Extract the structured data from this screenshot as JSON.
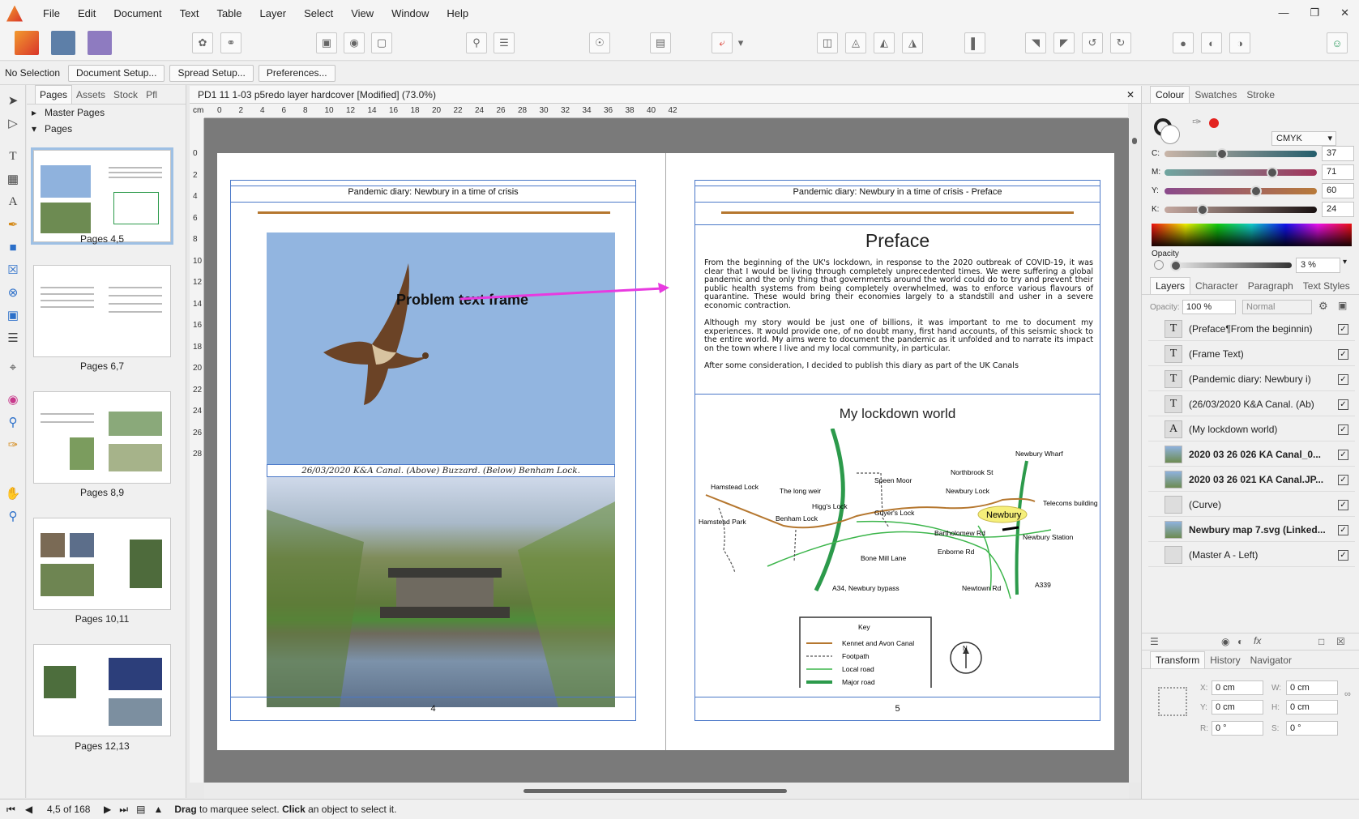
{
  "menu": [
    "File",
    "Edit",
    "Document",
    "Text",
    "Table",
    "Layer",
    "Select",
    "View",
    "Window",
    "Help"
  ],
  "context": {
    "selection": "No Selection",
    "buttons": [
      "Document Setup...",
      "Spread Setup...",
      "Preferences..."
    ]
  },
  "pages_panel": {
    "tabs": [
      "Pages",
      "Assets",
      "Stock",
      "Pfl"
    ],
    "master_pages": "Master Pages",
    "pages": "Pages",
    "thumbs": [
      "Pages 4,5",
      "Pages 6,7",
      "Pages 8,9",
      "Pages 10,11",
      "Pages 12,13"
    ]
  },
  "doc_tab": "PD1 11 1-03 p5redo layer hardcover [Modified] (73.0%)",
  "ruler": {
    "unit": "cm",
    "h": [
      "0",
      "2",
      "4",
      "6",
      "8",
      "10",
      "12",
      "14",
      "16",
      "18",
      "20",
      "22",
      "24",
      "26",
      "28",
      "30",
      "32",
      "34",
      "36",
      "38",
      "40",
      "42"
    ],
    "v": [
      "0",
      "2",
      "4",
      "6",
      "8",
      "10",
      "12",
      "14",
      "16",
      "18",
      "20",
      "22",
      "24",
      "26",
      "28"
    ]
  },
  "left_page": {
    "header": "Pandemic diary: Newbury in a time of crisis",
    "annotation": "Problem text frame",
    "caption": "26/03/2020 K&A Canal. (Above) Buzzard. (Below) Benham Lock.",
    "page_number": "4"
  },
  "right_page": {
    "header": "Pandemic diary: Newbury in a time of crisis - Preface",
    "title": "Preface",
    "para1": "From the beginning of the UK's lockdown, in response to the 2020 outbreak of COVID-19, it was clear that I would be living through completely unprecedented times. We were suffering a global pandemic and the only thing that governments around the world could do to try and prevent their public health systems from being completely overwhelmed, was to enforce various flavours of quarantine. These would bring their economies largely to a standstill and usher in a severe economic contraction.",
    "para2": "Although my story would be just one of billions, it was important to me to document my experiences. It would provide one, of no doubt many, first hand accounts, of this seismic shock to the entire world. My aims were to document the pandemic as it unfolded and to narrate its impact on the town where I live and my local community, in particular.",
    "para3": "After some consideration, I decided to publish this diary as part of the UK Canals",
    "map_title": "My lockdown world",
    "map_labels": {
      "hamstead_lock": "Hamstead Lock",
      "long_weir": "The long weir",
      "hamstead_park": "Hamstead Park",
      "benham_lock": "Benham Lock",
      "higgs_lock": "Higg's Lock",
      "speen_moor": "Speen Moor",
      "guyers_lock": "Guyer's Lock",
      "northbrook": "Northbrook St",
      "newbury_lock": "Newbury Lock",
      "newbury_wharf": "Newbury Wharf",
      "newbury": "Newbury",
      "telecoms": "Telecoms building",
      "bartholomew": "Bartholomew Rd",
      "newbury_station": "Newbury Station",
      "bone_mill": "Bone Mill Lane",
      "enborne": "Enborne Rd",
      "a34": "A34, Newbury bypass",
      "newtown": "Newtown Rd",
      "a339": "A339"
    },
    "key": {
      "title": "Key",
      "items": [
        "Kennet and Avon Canal",
        "Footpath",
        "Local road",
        "Major road"
      ]
    },
    "compass": "N",
    "page_number": "5"
  },
  "colour_panel": {
    "tabs": [
      "Colour",
      "Swatches",
      "Stroke"
    ],
    "model": "CMYK",
    "channels": [
      {
        "name": "C:",
        "value": "37"
      },
      {
        "name": "M:",
        "value": "71"
      },
      {
        "name": "Y:",
        "value": "60"
      },
      {
        "name": "K:",
        "value": "24"
      }
    ],
    "opacity_label": "Opacity",
    "opacity": "3 %"
  },
  "layers_panel": {
    "tabs": [
      "Layers",
      "Character",
      "Paragraph",
      "Text Styles"
    ],
    "opacity_label": "Opacity:",
    "opacity": "100 %",
    "blend": "Normal",
    "layers": [
      {
        "name": "(Preface¶From the beginnin)",
        "icon": "T"
      },
      {
        "name": "(Frame Text)",
        "icon": "T"
      },
      {
        "name": "(Pandemic diary: Newbury i)",
        "icon": "T"
      },
      {
        "name": "(26/03/2020 K&A Canal. (Ab)",
        "icon": "T"
      },
      {
        "name": "(My lockdown world)",
        "icon": "A"
      },
      {
        "name": "2020 03 26 026 KA Canal_0...",
        "icon": "img"
      },
      {
        "name": "2020 03 26 021 KA Canal.JP...",
        "icon": "img"
      },
      {
        "name": "(Curve)",
        "icon": ""
      },
      {
        "name": "Newbury map 7.svg (Linked...",
        "icon": "img"
      },
      {
        "name": "(Master A - Left)",
        "icon": ""
      }
    ]
  },
  "transform_panel": {
    "tabs": [
      "Transform",
      "History",
      "Navigator"
    ],
    "fields": [
      {
        "label": "X:",
        "value": "0 cm"
      },
      {
        "label": "W:",
        "value": "0 cm"
      },
      {
        "label": "Y:",
        "value": "0 cm"
      },
      {
        "label": "H:",
        "value": "0 cm"
      },
      {
        "label": "R:",
        "value": "0 °"
      },
      {
        "label": "S:",
        "value": "0 °"
      }
    ]
  },
  "status": {
    "page": "4,5 of 168",
    "hint_bold1": "Drag",
    "hint1": " to marquee select. ",
    "hint_bold2": "Click",
    "hint2": " an object to select it."
  },
  "colors": {
    "accent": "#4a78c8",
    "canal": "#b5772f",
    "arrow": "#e83ae0",
    "sky": "#8fb2dd"
  }
}
